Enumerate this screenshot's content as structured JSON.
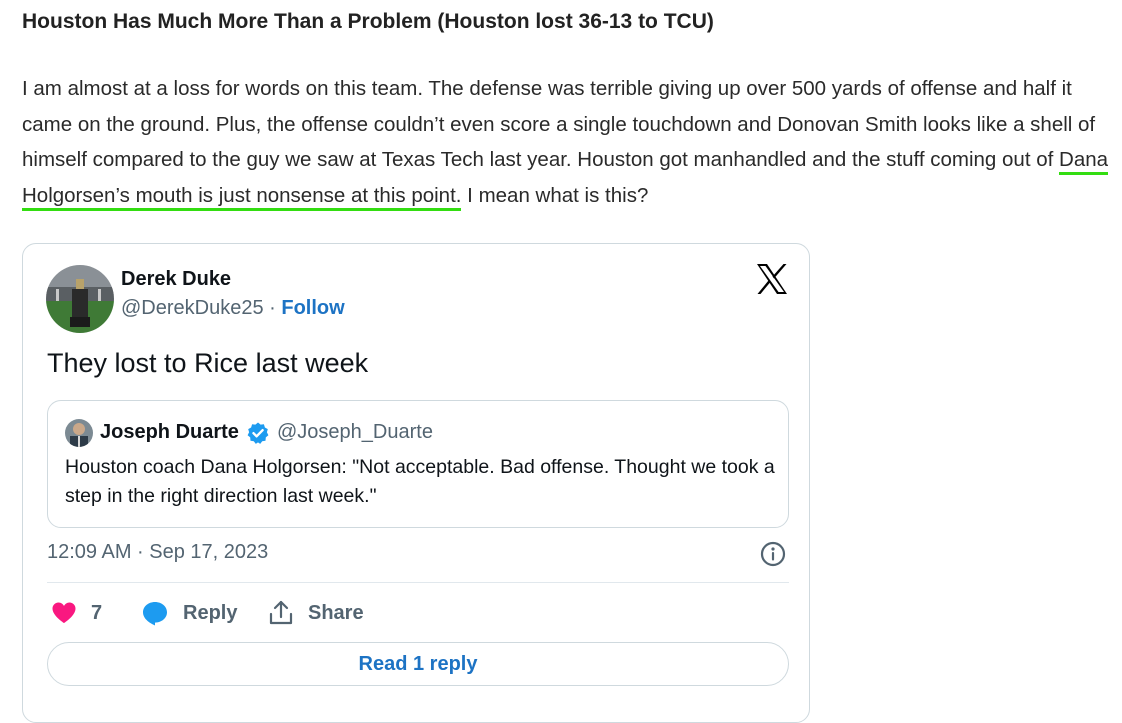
{
  "article": {
    "headline": "Houston Has Much More Than a Problem (Houston lost 36-13 to TCU)",
    "paragraph_before_link": "I am almost at a loss for words on this team. The defense was terrible giving up over 500 yards of offense and half it came on the ground. Plus, the offense couldn’t even score a single touchdown and Donovan Smith looks like a shell of himself compared to the guy we saw at Texas Tech last year. Houston got manhandled and the stuff coming out of ",
    "link_text": "Dana Holgorsen’s mouth is just nonsense at this point.",
    "paragraph_after_link": " I mean what is this?"
  },
  "tweet": {
    "author_name": "Derek Duke",
    "author_handle": "@DerekDuke25",
    "separator": " · ",
    "follow_label": "Follow",
    "text": "They lost to Rice last week",
    "quote": {
      "author_name": "Joseph Duarte",
      "author_handle": "@Joseph_Duarte",
      "text": "Houston coach Dana Holgorsen: \"Not acceptable. Bad offense. Thought we took a step in the right direction last week.\""
    },
    "timestamp": "12:09 AM · Sep 17, 2023",
    "like_count": "7",
    "reply_label": "Reply",
    "share_label": "Share",
    "read_replies_label": "Read 1 reply"
  },
  "icons": {
    "x_logo": "x-logo-icon",
    "verified": "verified-badge-icon",
    "info": "info-icon",
    "like": "heart-icon",
    "reply": "speech-bubble-icon",
    "share": "share-upload-icon"
  },
  "colors": {
    "link_underline": "#33dd11",
    "accent_blue": "#1d73c4",
    "like_pink": "#f91880",
    "reply_blue": "#1d9bf0",
    "muted_text": "#536471",
    "border": "#cfd9de"
  }
}
